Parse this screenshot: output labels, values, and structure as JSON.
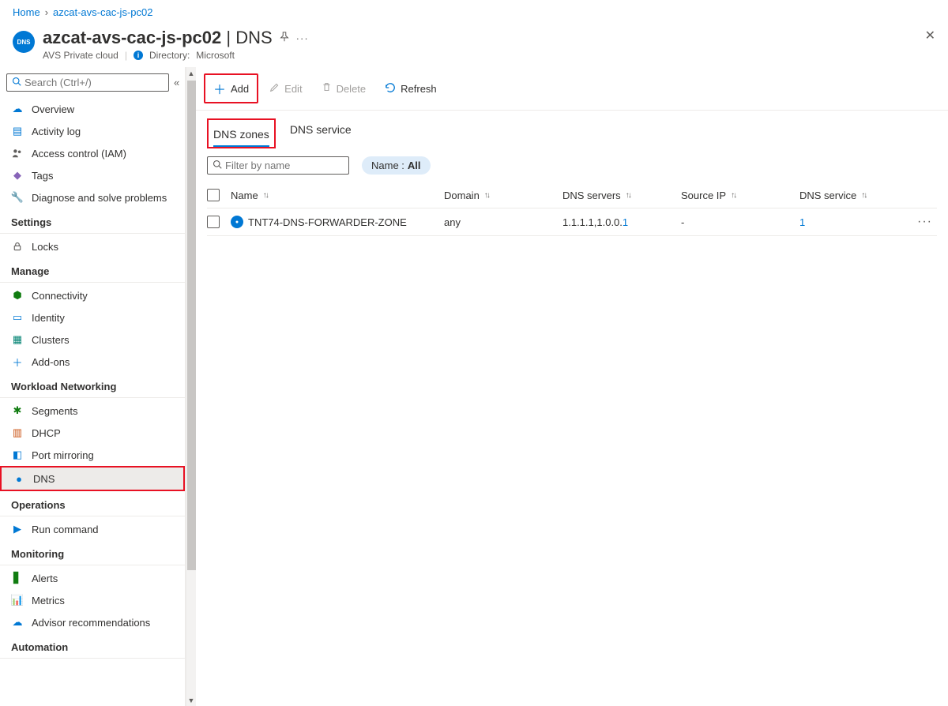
{
  "breadcrumb": {
    "home": "Home",
    "resource": "azcat-avs-cac-js-pc02"
  },
  "header": {
    "badge": "DNS",
    "title": "azcat-avs-cac-js-pc02",
    "title_suffix": "| DNS",
    "subtitle": "AVS Private cloud",
    "directory_label": "Directory:",
    "directory_value": "Microsoft"
  },
  "sidebar": {
    "search_placeholder": "Search (Ctrl+/)",
    "items_top": [
      {
        "label": "Overview",
        "icon": "cloud-icon",
        "color": "c-blue"
      },
      {
        "label": "Activity log",
        "icon": "log-icon",
        "color": "c-blue"
      },
      {
        "label": "Access control (IAM)",
        "icon": "people-icon",
        "color": "c-gray"
      },
      {
        "label": "Tags",
        "icon": "tag-icon",
        "color": "c-purple"
      },
      {
        "label": "Diagnose and solve problems",
        "icon": "diagnose-icon",
        "color": "c-gray"
      }
    ],
    "section_settings": "Settings",
    "items_settings": [
      {
        "label": "Locks",
        "icon": "lock-icon",
        "color": "c-gray"
      }
    ],
    "section_manage": "Manage",
    "items_manage": [
      {
        "label": "Connectivity",
        "icon": "connectivity-icon",
        "color": "c-green"
      },
      {
        "label": "Identity",
        "icon": "identity-icon",
        "color": "c-blue"
      },
      {
        "label": "Clusters",
        "icon": "clusters-icon",
        "color": "c-teal"
      },
      {
        "label": "Add-ons",
        "icon": "plus-icon",
        "color": "c-blue"
      }
    ],
    "section_workload": "Workload Networking",
    "items_workload": [
      {
        "label": "Segments",
        "icon": "segments-icon",
        "color": "c-green"
      },
      {
        "label": "DHCP",
        "icon": "dhcp-icon",
        "color": "c-orange"
      },
      {
        "label": "Port mirroring",
        "icon": "mirror-icon",
        "color": "c-blue"
      },
      {
        "label": "DNS",
        "icon": "dns-icon",
        "color": "c-blue",
        "selected": true
      }
    ],
    "section_operations": "Operations",
    "items_operations": [
      {
        "label": "Run command",
        "icon": "run-icon",
        "color": "c-blue"
      }
    ],
    "section_monitoring": "Monitoring",
    "items_monitoring": [
      {
        "label": "Alerts",
        "icon": "alerts-icon",
        "color": "c-green"
      },
      {
        "label": "Metrics",
        "icon": "metrics-icon",
        "color": "c-blue"
      },
      {
        "label": "Advisor recommendations",
        "icon": "advisor-icon",
        "color": "c-blue"
      }
    ],
    "section_automation": "Automation"
  },
  "toolbar": {
    "add": "Add",
    "edit": "Edit",
    "delete": "Delete",
    "refresh": "Refresh"
  },
  "tabs": {
    "dns_zones": "DNS zones",
    "dns_service": "DNS service"
  },
  "filter": {
    "placeholder": "Filter by name",
    "pill_label": "Name :",
    "pill_value": "All"
  },
  "table": {
    "headers": {
      "name": "Name",
      "domain": "Domain",
      "servers": "DNS servers",
      "sourceip": "Source IP",
      "service": "DNS service"
    },
    "rows": [
      {
        "name": "TNT74-DNS-FORWARDER-ZONE",
        "domain": "any",
        "servers_prefix": "1.1.1.1,1.0.0.",
        "servers_link": "1",
        "sourceip": "-",
        "service": "1"
      }
    ]
  }
}
